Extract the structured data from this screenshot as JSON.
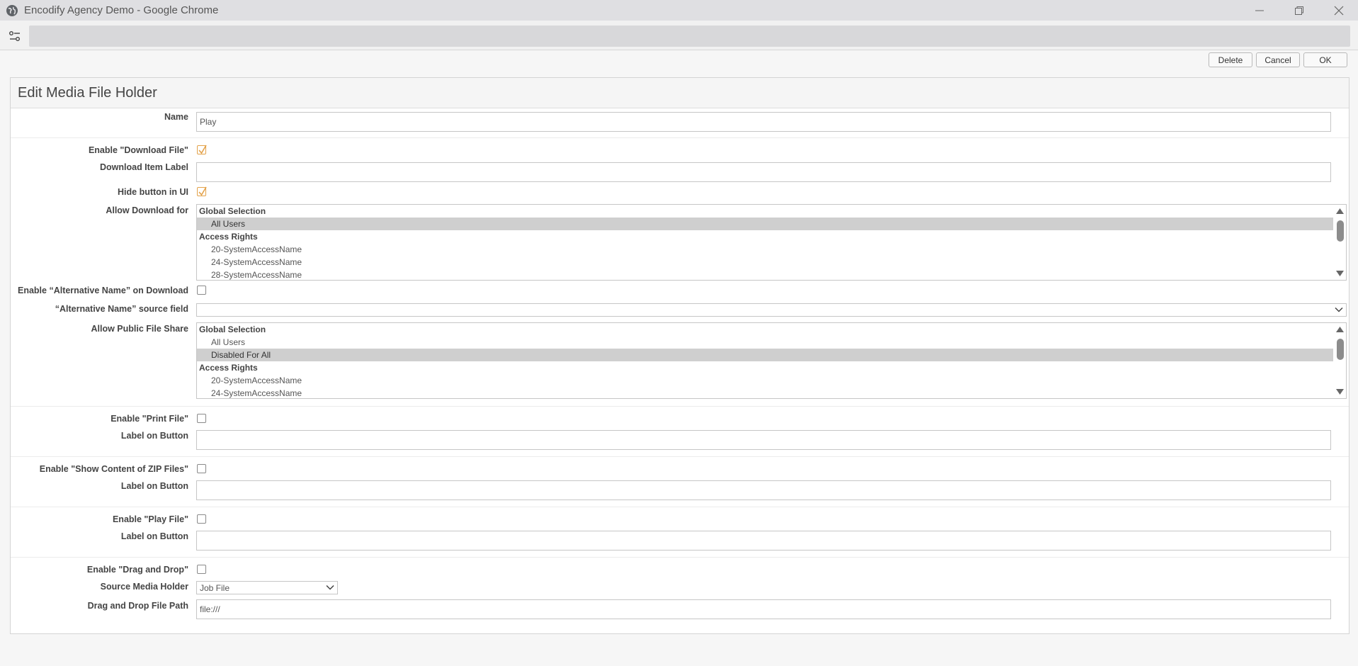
{
  "window": {
    "title": "Encodify Agency Demo - Google Chrome"
  },
  "actions": {
    "delete": "Delete",
    "cancel": "Cancel",
    "ok": "OK"
  },
  "panel": {
    "title": "Edit Media File Holder"
  },
  "fields": {
    "name": {
      "label": "Name",
      "value": "Play"
    },
    "enable_download": {
      "label": "Enable \"Download File\"",
      "checked": true
    },
    "download_item_label": {
      "label": "Download Item Label",
      "value": ""
    },
    "hide_button": {
      "label": "Hide button in UI",
      "checked": true
    },
    "allow_download_for": {
      "label": "Allow Download for",
      "rows": [
        {
          "text": "Global Selection",
          "kind": "group"
        },
        {
          "text": "All Users",
          "kind": "opt",
          "selected": true
        },
        {
          "text": "Access Rights",
          "kind": "group"
        },
        {
          "text": "20-SystemAccessName",
          "kind": "opt"
        },
        {
          "text": "24-SystemAccessName",
          "kind": "opt"
        },
        {
          "text": "28-SystemAccessName",
          "kind": "opt"
        }
      ]
    },
    "enable_alt_name": {
      "label": "Enable “Alternative Name” on Download",
      "checked": false
    },
    "alt_name_source": {
      "label": "“Alternative Name” source field",
      "value": ""
    },
    "allow_public_share": {
      "label": "Allow Public File Share",
      "rows": [
        {
          "text": "Global Selection",
          "kind": "group"
        },
        {
          "text": "All Users",
          "kind": "opt"
        },
        {
          "text": "Disabled For All",
          "kind": "opt",
          "selected": true
        },
        {
          "text": "Access Rights",
          "kind": "group"
        },
        {
          "text": "20-SystemAccessName",
          "kind": "opt"
        },
        {
          "text": "24-SystemAccessName",
          "kind": "opt"
        }
      ]
    },
    "enable_print": {
      "label": "Enable \"Print File\"",
      "checked": false
    },
    "print_label": {
      "label": "Label on Button",
      "value": ""
    },
    "enable_zip": {
      "label": "Enable \"Show Content of ZIP Files\"",
      "checked": false
    },
    "zip_label": {
      "label": "Label on Button",
      "value": ""
    },
    "enable_play": {
      "label": "Enable \"Play File\"",
      "checked": false
    },
    "play_label": {
      "label": "Label on Button",
      "value": ""
    },
    "enable_dnd": {
      "label": "Enable \"Drag and Drop\"",
      "checked": false
    },
    "source_media_holder": {
      "label": "Source Media Holder",
      "value": "Job File"
    },
    "dnd_path": {
      "label": "Drag and Drop File Path",
      "value": "file:///"
    }
  },
  "colors": {
    "checkmark": "#e3a24a",
    "selected_row": "#cfcfcf"
  }
}
